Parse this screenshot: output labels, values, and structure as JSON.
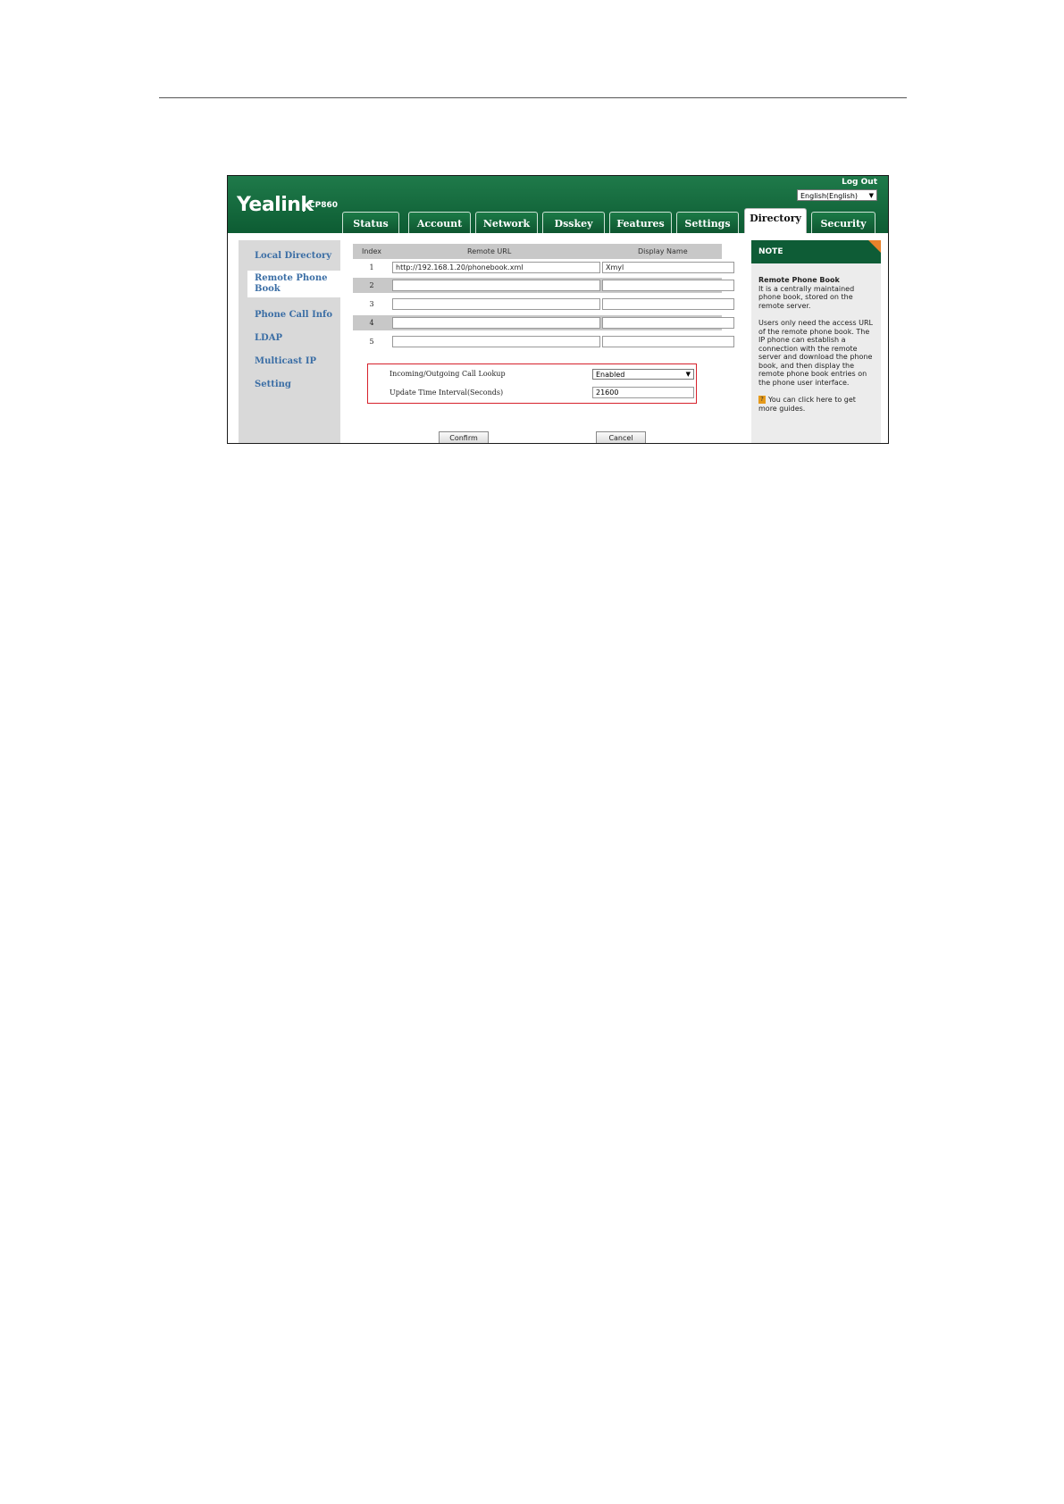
{
  "header": {
    "logo": "Yealink",
    "model": "CP860",
    "logout": "Log Out",
    "language": "English(English)"
  },
  "tabs": [
    "Status",
    "Account",
    "Network",
    "Dsskey",
    "Features",
    "Settings",
    "Directory",
    "Security"
  ],
  "active_tab": "Directory",
  "sidebar": {
    "items": [
      "Local Directory",
      "Remote Phone Book",
      "Phone Call Info",
      "LDAP",
      "Multicast IP",
      "Setting"
    ],
    "active": "Remote Phone Book"
  },
  "table": {
    "headers": {
      "index": "Index",
      "url": "Remote URL",
      "name": "Display Name"
    },
    "rows": [
      {
        "index": "1",
        "url": "http://192.168.1.20/phonebook.xml",
        "name": "Xmyl"
      },
      {
        "index": "2",
        "url": "",
        "name": ""
      },
      {
        "index": "3",
        "url": "",
        "name": ""
      },
      {
        "index": "4",
        "url": "",
        "name": ""
      },
      {
        "index": "5",
        "url": "",
        "name": ""
      }
    ]
  },
  "settings": {
    "lookup_label": "Incoming/Outgoing Call Lookup",
    "lookup_value": "Enabled",
    "interval_label": "Update Time Interval(Seconds)",
    "interval_value": "21600"
  },
  "buttons": {
    "confirm": "Confirm",
    "cancel": "Cancel"
  },
  "note": {
    "header": "NOTE",
    "title": "Remote Phone Book",
    "para1": "It is a centrally maintained phone book, stored on the remote server.",
    "para2": "Users only need the access URL of the remote phone book. The IP phone can establish a connection with the remote server and download the phone book, and then display the remote phone book entries on the phone user interface.",
    "guide": "You can click here to get more guides."
  }
}
